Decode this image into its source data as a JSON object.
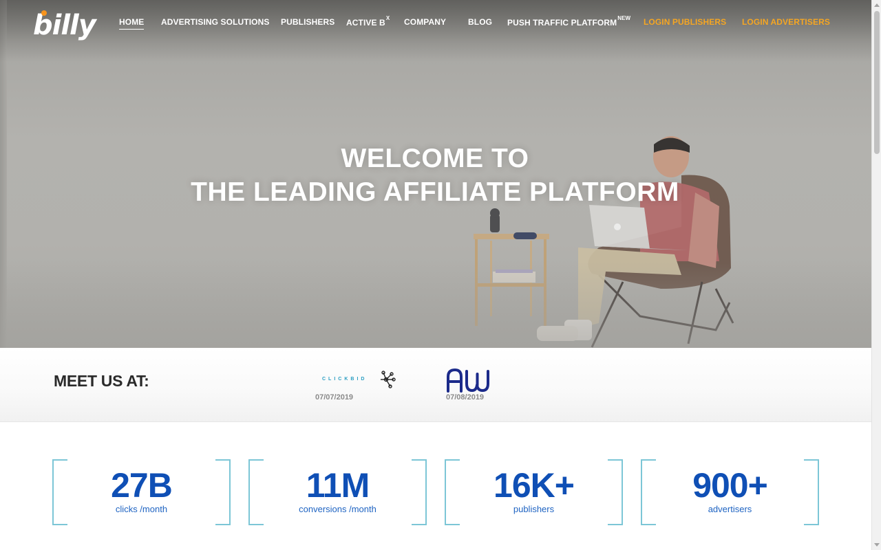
{
  "brand": {
    "name": "billy",
    "accent_color": "#f7941d"
  },
  "nav": {
    "items": [
      {
        "label": "HOME",
        "active": true
      },
      {
        "label": "ADVERTISING SOLUTIONS"
      },
      {
        "label": "PUBLISHERS"
      },
      {
        "label": "ACTIVE B",
        "sup": "X"
      },
      {
        "label": "COMPANY"
      },
      {
        "label": "BLOG"
      },
      {
        "label": "PUSH TRAFFIC PLATFORM",
        "sup": "NEW"
      }
    ],
    "login_publishers": "LOGIN PUBLISHERS",
    "login_advertisers": "LOGIN ADVERTISERS",
    "login_color": "#f5a623"
  },
  "hero": {
    "line1": "WELCOME TO",
    "line2": "THE LEADING AFFILIATE PLATFORM"
  },
  "meet": {
    "title": "MEET US AT:",
    "events": [
      {
        "logo": "CLICKBID",
        "date": "07/07/2019"
      },
      {
        "logo": "AW",
        "date": "07/08/2019"
      }
    ]
  },
  "stats": [
    {
      "value": "27B",
      "label": "clicks /month"
    },
    {
      "value": "11M",
      "label": "conversions /month"
    },
    {
      "value": "16K+",
      "label": "publishers"
    },
    {
      "value": "900+",
      "label": "advertisers"
    }
  ],
  "colors": {
    "stat_value": "#0f4fb5",
    "stat_label": "#1e63c2",
    "bracket": "#7cc6d6"
  }
}
